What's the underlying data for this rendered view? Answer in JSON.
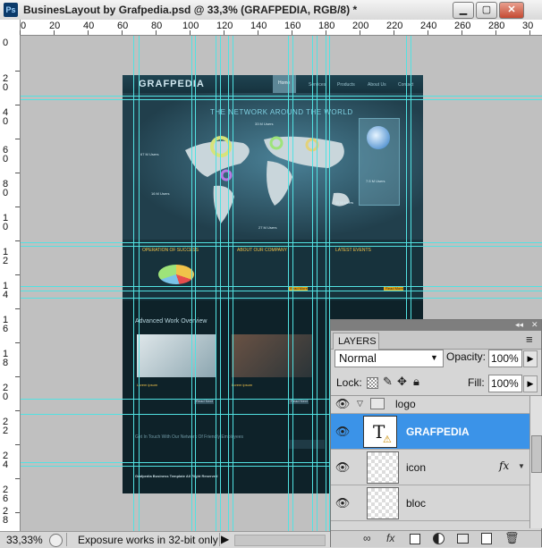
{
  "window": {
    "app_icon": "Ps",
    "title": "BusinesLayout by Grafpedia.psd @ 33,3% (GRAFPEDIA, RGB/8) *",
    "minimize": "▁",
    "maximize": "▢",
    "close": "✕"
  },
  "ruler": {
    "top": [
      "0",
      "20",
      "40",
      "60",
      "80",
      "100",
      "120",
      "140",
      "160",
      "180",
      "200",
      "220",
      "240",
      "260",
      "280",
      "30"
    ],
    "left": [
      "0",
      "20",
      "40",
      "60",
      "80",
      "10",
      "12",
      "14",
      "16",
      "18",
      "20",
      "22",
      "24",
      "26",
      "28",
      "30"
    ]
  },
  "site": {
    "logo_text": "GRAFPEDIA",
    "nav": [
      "Home",
      "Services",
      "Products",
      "About Us",
      "Contact"
    ],
    "headline": "THE NETWORK AROUND THE WORLD",
    "map_labels": [
      "67 M Users",
      "33 M Users",
      "27 M Users",
      "16 M Users",
      "11 M Users",
      "7.5 M Users"
    ],
    "section_titles": [
      "OPERATION OF SUCCESS",
      "ABOUT OUR COMPANY",
      "LATEST EVENTS"
    ],
    "more_button": "Read More",
    "bottom_title": "Advanced Work Overview",
    "card_links": [
      "Lorem ipsum",
      "Lorem ipsum"
    ],
    "card_more": "Read Next",
    "contact_title": "Get In Touch With Our Network Of Friendly Employees",
    "footer": "Grafpedia Business Template All Right Reserved"
  },
  "status": {
    "zoom": "33,33%",
    "info": "Exposure works in 32-bit only",
    "arrow": "▶"
  },
  "panel": {
    "collapse": "◂◂",
    "close": "✕",
    "tab": "LAYERS",
    "menu": "≡",
    "blend_mode": "Normal",
    "opacity_label": "Opacity:",
    "opacity_value": "100%",
    "lock_label": "Lock:",
    "fill_label": "Fill:",
    "fill_value": "100%",
    "layers": [
      {
        "name": "logo",
        "type": "group"
      },
      {
        "name": "GRAFPEDIA",
        "type": "text",
        "selected": true
      },
      {
        "name": "icon",
        "type": "pixel",
        "fx": "fx"
      },
      {
        "name": "bloc",
        "type": "pixel"
      }
    ]
  },
  "colors": {
    "guide": "#52e2e2",
    "selection": "#3b93e8",
    "site_bg": "#10262f"
  }
}
